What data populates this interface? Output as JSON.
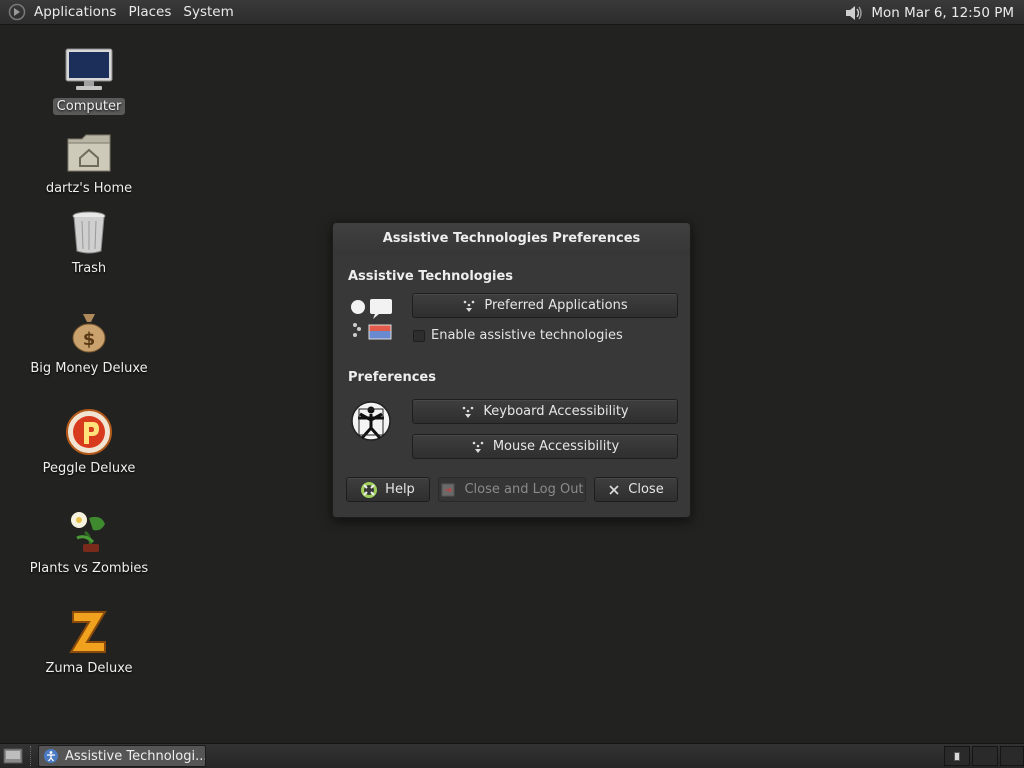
{
  "top_panel": {
    "menus": [
      "Applications",
      "Places",
      "System"
    ],
    "clock": "Mon Mar  6, 12:50 PM",
    "foot_icon": "gnome-foot-icon",
    "volume_icon": "volume-icon"
  },
  "desktop": {
    "icons": [
      {
        "label": "Computer",
        "icon": "computer-icon"
      },
      {
        "label": "dartz's Home",
        "icon": "home-folder-icon"
      },
      {
        "label": "Trash",
        "icon": "trash-icon"
      },
      {
        "label": "Big Money Deluxe",
        "icon": "money-bag-icon"
      },
      {
        "label": "Peggle Deluxe",
        "icon": "peggle-icon"
      },
      {
        "label": "Plants vs Zombies",
        "icon": "plants-vs-zombies-icon"
      },
      {
        "label": "Zuma Deluxe",
        "icon": "zuma-icon"
      }
    ]
  },
  "dialog": {
    "title": "Assistive Technologies Preferences",
    "section_assistive": "Assistive Technologies",
    "preferred_applications": "Preferred Applications",
    "enable_assistive": "Enable assistive technologies",
    "section_preferences": "Preferences",
    "keyboard_accessibility": "Keyboard Accessibility",
    "mouse_accessibility": "Mouse Accessibility",
    "help": "Help",
    "close_logout": "Close and Log Out",
    "close": "Close"
  },
  "bottom_panel": {
    "task": "Assistive Technologi..."
  },
  "colors": {
    "desktop_bg": "#222220",
    "dialog_bg": "#383838",
    "task_active": "#555555"
  }
}
